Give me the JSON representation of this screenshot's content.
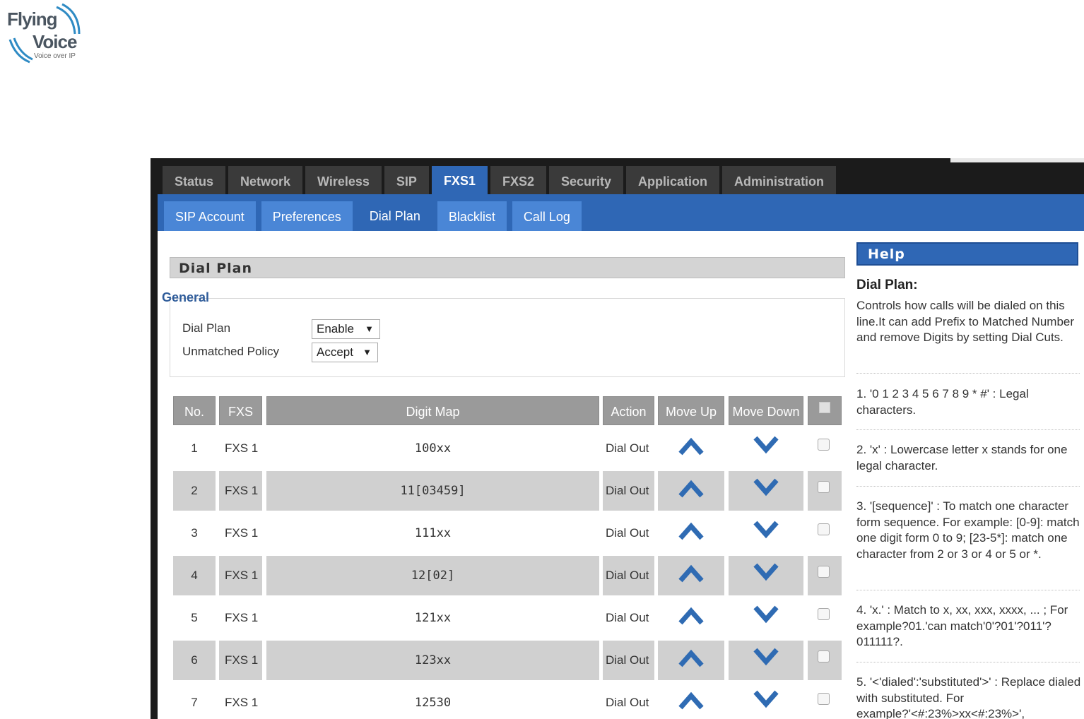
{
  "logo": {
    "line1": "Flying",
    "line2": "Voice",
    "tagline": "Voice over IP"
  },
  "main_tabs": [
    {
      "label": "Status",
      "active": false
    },
    {
      "label": "Network",
      "active": false
    },
    {
      "label": "Wireless",
      "active": false
    },
    {
      "label": "SIP",
      "active": false
    },
    {
      "label": "FXS1",
      "active": true
    },
    {
      "label": "FXS2",
      "active": false
    },
    {
      "label": "Security",
      "active": false
    },
    {
      "label": "Application",
      "active": false
    },
    {
      "label": "Administration",
      "active": false
    }
  ],
  "sub_tabs": [
    {
      "label": "SIP Account",
      "active": false
    },
    {
      "label": "Preferences",
      "active": false
    },
    {
      "label": "Dial Plan",
      "active": true
    },
    {
      "label": "Blacklist",
      "active": false
    },
    {
      "label": "Call Log",
      "active": false
    }
  ],
  "section": {
    "title": "Dial Plan"
  },
  "general": {
    "legend": "General",
    "dial_plan_label": "Dial Plan",
    "dial_plan_value": "Enable",
    "unmatched_policy_label": "Unmatched Policy",
    "unmatched_policy_value": "Accept"
  },
  "table": {
    "headers": {
      "no": "No.",
      "fxs": "FXS",
      "digit_map": "Digit Map",
      "action": "Action",
      "move_up": "Move Up",
      "move_down": "Move Down"
    },
    "rows": [
      {
        "no": "1",
        "fxs": "FXS 1",
        "digit_map": "100xx",
        "action": "Dial Out"
      },
      {
        "no": "2",
        "fxs": "FXS 1",
        "digit_map": "11[03459]",
        "action": "Dial Out"
      },
      {
        "no": "3",
        "fxs": "FXS 1",
        "digit_map": "111xx",
        "action": "Dial Out"
      },
      {
        "no": "4",
        "fxs": "FXS 1",
        "digit_map": "12[02]",
        "action": "Dial Out"
      },
      {
        "no": "5",
        "fxs": "FXS 1",
        "digit_map": "121xx",
        "action": "Dial Out"
      },
      {
        "no": "6",
        "fxs": "FXS 1",
        "digit_map": "123xx",
        "action": "Dial Out"
      },
      {
        "no": "7",
        "fxs": "FXS 1",
        "digit_map": "12530",
        "action": "Dial Out"
      }
    ]
  },
  "help": {
    "title": "Help",
    "subtitle": "Dial Plan:",
    "intro": "Controls how calls will be dialed on this line.It can add Prefix to Matched Number and remove Digits by setting Dial Cuts.",
    "items": [
      "1. '0 1 2 3 4 5 6 7 8 9 * #' : Legal characters.",
      "2. 'x' : Lowercase letter x stands for one legal character.",
      "3. '[sequence]' : To match one character form sequence. For example: [0-9]: match one digit form 0 to 9; [23-5*]: match one character from 2 or 3 or 4 or 5 or *.",
      "4. 'x.' : Match to x, xx, xxx, xxxx, ... ; For example?01.'can match'0'?01'?011'?011111?.",
      "5. '<'dialed':'substituted'>' : Replace dialed with substituted. For example?'<#:23%>xx<#:23%>',"
    ]
  },
  "colors": {
    "accent": "#2f67b5",
    "tab_inactive": "#3a3a3a",
    "subtab": "#4a86d6",
    "table_header": "#9a9a9a",
    "row_alt": "#d0d0d0",
    "arrow": "#2f6bb3"
  },
  "icons": {
    "move_up": "chevron-up-icon",
    "move_down": "chevron-down-icon"
  }
}
